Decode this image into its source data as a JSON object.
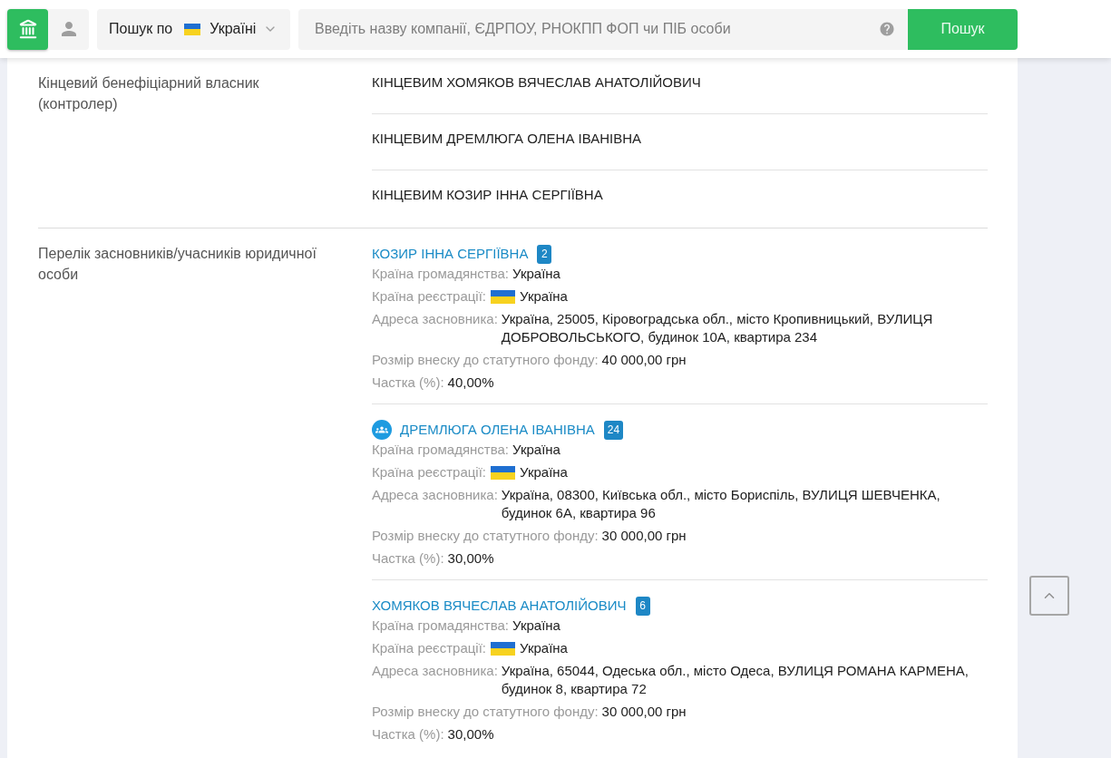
{
  "header": {
    "scope": {
      "label": "Пошук по",
      "country": "Україні"
    },
    "search": {
      "placeholder": "Введіть назву компанії, ЄДРПОУ, РНОКПП ФОП чи ПІБ особи"
    },
    "search_button": "Пошук"
  },
  "sections": [
    {
      "kind": "beneficiaries",
      "label": "Кінцевий бенефіціарний власник (контролер)",
      "items": [
        "КІНЦЕВИМ ХОМЯКОВ ВЯЧЕСЛАВ АНАТОЛІЙОВИЧ",
        "КІНЦЕВИМ ДРЕМЛЮГА ОЛЕНА ІВАНІВНА",
        "КІНЦЕВИМ КОЗИР ІННА СЕРГІЇВНА"
      ]
    },
    {
      "kind": "founders",
      "label": "Перелік засновників/учасників юридичної особи",
      "founders": [
        {
          "name": "КОЗИР ІННА СЕРГІЇВНА",
          "count": "2",
          "group_icon": false,
          "fields": [
            {
              "kind": "text",
              "label": "Країна громадянства:",
              "value": "Україна"
            },
            {
              "kind": "flag",
              "label": "Країна реєстрації:",
              "value": "Україна"
            },
            {
              "kind": "text",
              "label": "Адреса засновника:",
              "value": "Україна, 25005, Кіровоградська обл., місто Кропивницький, ВУЛИЦЯ ДОБРОВОЛЬСЬКОГО, будинок 10А, квартира 234"
            },
            {
              "kind": "text",
              "label": "Розмір внеску до статутного фонду:",
              "value": "40 000,00 грн"
            },
            {
              "kind": "text",
              "label": "Частка (%):",
              "value": "40,00%"
            }
          ]
        },
        {
          "name": "ДРЕМЛЮГА ОЛЕНА ІВАНІВНА",
          "count": "24",
          "group_icon": true,
          "fields": [
            {
              "kind": "text",
              "label": "Країна громадянства:",
              "value": "Україна"
            },
            {
              "kind": "flag",
              "label": "Країна реєстрації:",
              "value": "Україна"
            },
            {
              "kind": "text",
              "label": "Адреса засновника:",
              "value": "Україна, 08300, Київська обл., місто Бориспіль, ВУЛИЦЯ ШЕВЧЕНКА, будинок 6А, квартира 96"
            },
            {
              "kind": "text",
              "label": "Розмір внеску до статутного фонду:",
              "value": "30 000,00 грн"
            },
            {
              "kind": "text",
              "label": "Частка (%):",
              "value": "30,00%"
            }
          ]
        },
        {
          "name": "ХОМЯКОВ ВЯЧЕСЛАВ АНАТОЛІЙОВИЧ",
          "count": "6",
          "group_icon": false,
          "fields": [
            {
              "kind": "text",
              "label": "Країна громадянства:",
              "value": "Україна"
            },
            {
              "kind": "flag",
              "label": "Країна реєстрації:",
              "value": "Україна"
            },
            {
              "kind": "text",
              "label": "Адреса засновника:",
              "value": "Україна, 65044, Одеська обл., місто Одеса, ВУЛИЦЯ РОМАНА КАРМЕНА, будинок 8, квартира 72"
            },
            {
              "kind": "text",
              "label": "Розмір внеску до статутного фонду:",
              "value": "30 000,00 грн"
            },
            {
              "kind": "text",
              "label": "Частка (%):",
              "value": "30,00%"
            }
          ]
        }
      ]
    }
  ]
}
